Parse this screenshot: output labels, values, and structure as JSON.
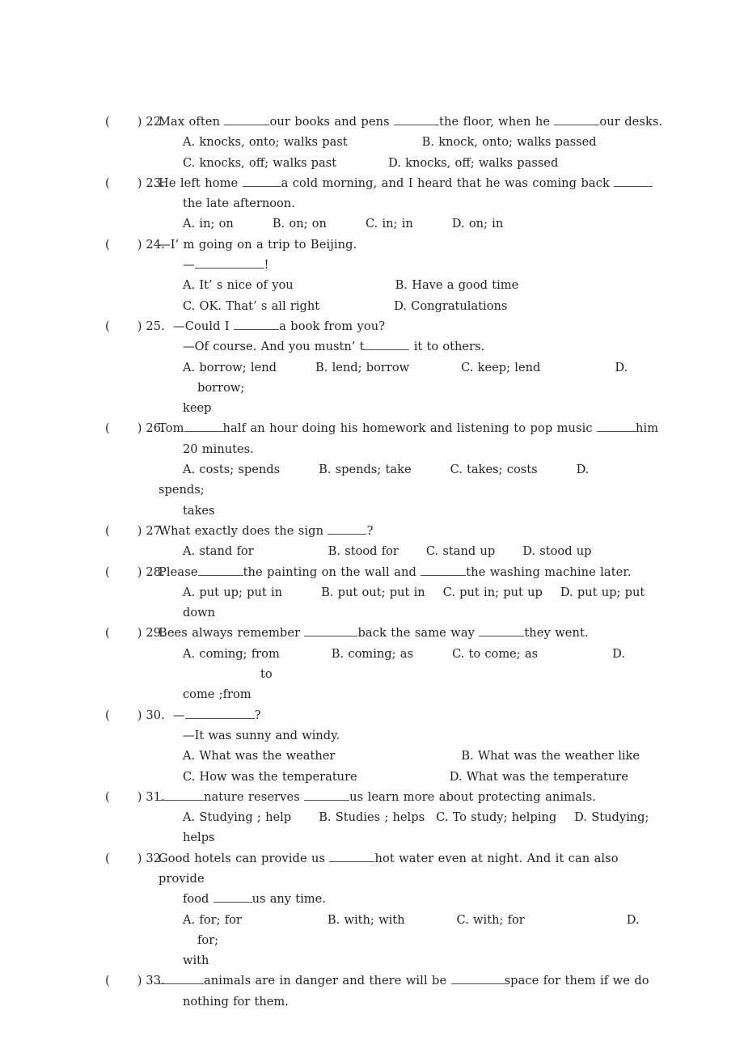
{
  "document": {
    "type": "english-grammar-multiple-choice-worksheet",
    "paper_background": "#ffffff",
    "text_color": "#231f20",
    "blank_rule_color": "#4a4a4a"
  },
  "questions": [
    {
      "id": "q22",
      "bracket": "(",
      "bracket_close": ")",
      "number": "22.",
      "stem_parts": [
        "Max often ",
        "our books and pens ",
        "the floor, when he ",
        "our desks."
      ],
      "stem_text": "Max often ______our books and pens ______the floor, when he ______our desks.",
      "option_rows": [
        {
          "left": "A. knocks, onto; walks past",
          "right": "B. knock, onto; walks passed"
        },
        {
          "left": "C. knocks, off; walks past",
          "right": "D. knocks, off; walks passed"
        }
      ]
    },
    {
      "id": "q23",
      "bracket": "(",
      "bracket_close": ")",
      "number": "23.",
      "stem_parts": [
        "He left home ",
        "a cold morning, and I heard that he was coming back ",
        ""
      ],
      "stem_text": "He left home ______a cold morning, and I heard that he was coming back _____",
      "continuation": "the late afternoon.",
      "option_rows": [
        {
          "single": "A. in; on        B. on; on        C. in; in        D. on; in",
          "opts": [
            "A. in; on",
            "B. on; on",
            "C. in; in",
            "D. on; in"
          ]
        }
      ]
    },
    {
      "id": "q24",
      "bracket": "(",
      "bracket_close": ")",
      "number": "24.",
      "stem_text": "—I’ m going on a trip to Beijing.",
      "dialogue_reply": "—________!",
      "option_rows": [
        {
          "left": "A. It’ s nice of you",
          "right": "B. Have a good time"
        },
        {
          "left": "C. OK. That’ s all right",
          "right": "D. Congratulations"
        }
      ]
    },
    {
      "id": "q25",
      "bracket": "(",
      "bracket_close": ")",
      "number": "25.",
      "stem_text": "—Could I ______a book from you?",
      "dialogue_reply": "—Of course. And you mustn’ t______ it to others.",
      "option_rows": [
        {
          "opts": [
            "A. borrow; lend",
            "B. lend; borrow",
            "C. keep; lend",
            "D.",
            "borrow;"
          ]
        }
      ],
      "wrapped_tail": "keep"
    },
    {
      "id": "q26",
      "bracket": "(",
      "bracket_close": ")",
      "number": "26.",
      "stem_text": "Tom_____half an hour doing his homework and listening to pop music ______him",
      "continuation": "20 minutes.",
      "option_rows": [
        {
          "opts": [
            "A. costs; spends",
            "B. spends; take",
            "C. takes; costs",
            "D.",
            "spends;"
          ]
        }
      ],
      "wrapped_tail": "takes"
    },
    {
      "id": "q27",
      "bracket": "(",
      "bracket_close": ")",
      "number": "27.",
      "stem_text": "What exactly does the sign ______?",
      "option_rows": [
        {
          "opts": [
            "A. stand for",
            "B. stood for",
            "C. stand up",
            "D. stood up"
          ]
        }
      ]
    },
    {
      "id": "q28",
      "bracket": "(",
      "bracket_close": ")",
      "number": "28.",
      "stem_text": "Please______the painting on the wall and ______the washing machine later.",
      "option_rows": [
        {
          "opts": [
            "A. put up; put in",
            "B. put out; put in",
            "C. put in; put up",
            "D. put up; put"
          ]
        }
      ],
      "wrapped_tail": "down"
    },
    {
      "id": "q29",
      "bracket": "(",
      "bracket_close": ")",
      "number": "29.",
      "stem_text": "Bees always remember ________back the same way ______they went.",
      "option_rows": [
        {
          "opts": [
            "A. coming; from",
            "B. coming; as",
            "C. to come; as",
            "D.",
            "to"
          ]
        }
      ],
      "wrapped_tail": "come ;from"
    },
    {
      "id": "q30",
      "bracket": "(",
      "bracket_close": ")",
      "number": "30.",
      "stem_text": "—____________?",
      "dialogue_reply": "—It was sunny and windy.",
      "option_rows": [
        {
          "left": "A. What was the weather",
          "right": "B. What was the weather like"
        },
        {
          "left": "C. How was the temperature",
          "right": "D. What was the temperature"
        }
      ]
    },
    {
      "id": "q31",
      "bracket": "(",
      "bracket_close": ")",
      "number": "31.",
      "stem_text": "______nature reserves _______us learn more about protecting animals.",
      "option_rows": [
        {
          "opts": [
            "A. Studying ; help",
            "B. Studies ; helps",
            "C. To study; helping",
            "D. Studying;"
          ]
        }
      ],
      "wrapped_tail": "helps"
    },
    {
      "id": "q32",
      "bracket": "(",
      "bracket_close": ")",
      "number": "32.",
      "stem_text": "Good hotels can provide us _______hot water even at night. And it can also provide",
      "continuation": "food ______us any time.",
      "option_rows": [
        {
          "opts": [
            "A. for; for",
            "B. with; with",
            "C. with; for",
            "D.",
            "for;"
          ]
        }
      ],
      "wrapped_tail": "with"
    },
    {
      "id": "q33",
      "bracket": "(",
      "bracket_close": ")",
      "number": "33.",
      "stem_text": "______animals are in danger and there will be _______space for them if we do",
      "continuation": "nothing for them."
    }
  ],
  "labels": {
    "q22_stem_a": "Max often ",
    "q22_stem_b": "our books and pens ",
    "q22_stem_c": "the floor, when he ",
    "q22_stem_d": "our desks.",
    "q22_optA": "A. knocks, onto; walks past",
    "q22_optB": "B. knock, onto; walks passed",
    "q22_optC": "C. knocks, off; walks past",
    "q22_optD": "D. knocks, off; walks passed",
    "q23_stem_a": "He left home ",
    "q23_stem_b": "a cold morning, and I heard that he was coming back ",
    "q23_cont": "the late afternoon.",
    "q23_optA": "A. in; on",
    "q23_optB": "B. on; on",
    "q23_optC": "C. in; in",
    "q23_optD": "D. on; in",
    "q24_stem": "—I’ m going on a trip to Beijing.",
    "q24_reply_dash": "—",
    "q24_reply_mark": "!",
    "q24_optA": "A. It’ s nice of you",
    "q24_optB": "B. Have a good time",
    "q24_optC": "C. OK. That’ s all right",
    "q24_optD": "D. Congratulations",
    "q25_stem_a": "—Could I ",
    "q25_stem_b": "a book from you?",
    "q25_reply_a": "—Of course. And you mustn’ t",
    "q25_reply_b": " it to others.",
    "q25_optA": "A. borrow; lend",
    "q25_optB": "B. lend; borrow",
    "q25_optC": "C. keep; lend",
    "q25_optD": "D.",
    "q25_optD_text": "borrow;",
    "q25_tail": "keep",
    "q26_stem_a": "Tom",
    "q26_stem_b": "half an hour doing his homework and listening to pop music ",
    "q26_stem_c": "him",
    "q26_cont": "20 minutes.",
    "q26_optA": "A. costs; spends",
    "q26_optB": "B. spends; take",
    "q26_optC": "C. takes; costs",
    "q26_optD": "D.",
    "q26_optD_text": "spends;",
    "q26_tail": "takes",
    "q27_stem_a": "What exactly does the sign ",
    "q27_stem_b": "?",
    "q27_optA": "A. stand for",
    "q27_optB": "B. stood for",
    "q27_optC": "C. stand up",
    "q27_optD": "D. stood up",
    "q28_stem_a": "Please",
    "q28_stem_b": "the painting on the wall and ",
    "q28_stem_c": "the washing machine later.",
    "q28_optA": "A. put up; put in",
    "q28_optB": "B. put out; put in",
    "q28_optC": "C. put in; put up",
    "q28_optD": "D. put up; put",
    "q28_tail": "down",
    "q29_stem_a": "Bees always remember ",
    "q29_stem_b": "back the same way ",
    "q29_stem_c": "they went.",
    "q29_optA": "A. coming; from",
    "q29_optB": "B. coming; as",
    "q29_optC": "C. to come; as",
    "q29_optD": "D.",
    "q29_optD_text": "to",
    "q29_tail": "come ;from",
    "q30_stem_dash": "—",
    "q30_stem_mark": "?",
    "q30_reply": "—It was sunny and windy.",
    "q30_optA": "A. What was the weather",
    "q30_optB": "B. What was the weather like",
    "q30_optC": "C. How was the temperature",
    "q30_optD": "D. What was the temperature",
    "q31_stem_a": "nature reserves ",
    "q31_stem_b": "us learn more about protecting animals.",
    "q31_optA": "A. Studying ; help",
    "q31_optB": "B. Studies ; helps",
    "q31_optC": "C. To study; helping",
    "q31_optD": "D. Studying;",
    "q31_tail": "helps",
    "q32_stem_a": "Good hotels can provide us ",
    "q32_stem_b": "hot water even at night. And it can also provide",
    "q32_cont_a": "food ",
    "q32_cont_b": "us any time.",
    "q32_optA": "A. for; for",
    "q32_optB": "B. with; with",
    "q32_optC": "C. with; for",
    "q32_optD": "D.",
    "q32_optD_text": "for;",
    "q32_tail": "with",
    "q33_stem_a": "animals are in danger and there will be ",
    "q33_stem_b": "space for them if we do",
    "q33_cont": "nothing for them.",
    "bracket_open": "(",
    "bracket_close": ")",
    "n22": "22.",
    "n23": "23.",
    "n24": "24.",
    "n25": "25.",
    "n26": "26.",
    "n27": "27.",
    "n28": "28.",
    "n29": "29.",
    "n30": "30.",
    "n31": "31.",
    "n32": "32.",
    "n33": "33."
  }
}
